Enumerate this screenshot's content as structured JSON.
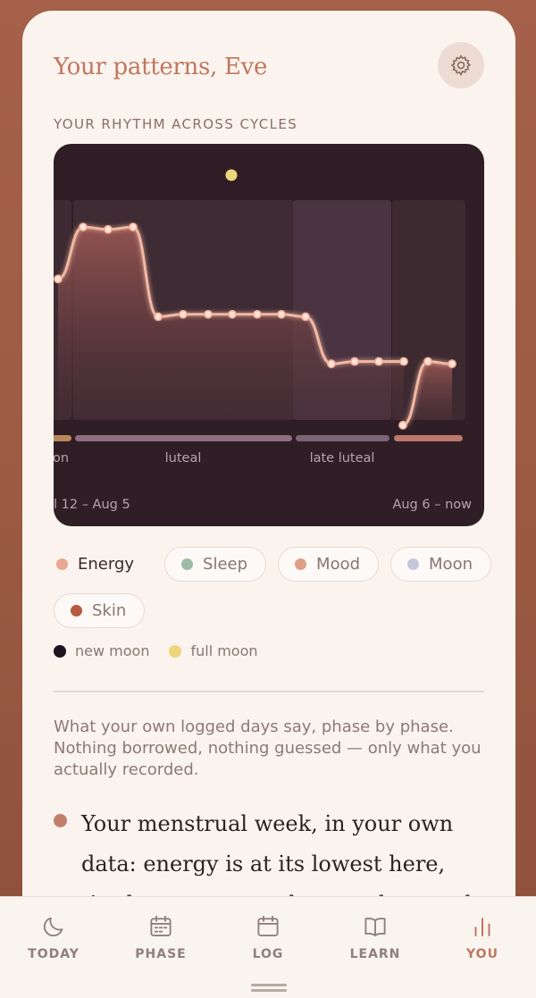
{
  "header": {
    "title": "Your patterns, Eve",
    "settings_icon": "gear-icon"
  },
  "section_label": "YOUR RHYTHM ACROSS CYCLES",
  "chart_data": {
    "type": "area",
    "series": [
      {
        "name": "Energy",
        "segment": 1,
        "values": [
          3.5,
          4.6,
          4.55,
          4.6,
          2.7,
          2.75,
          2.75,
          2.75,
          2.75,
          2.75,
          2.7,
          1.7,
          1.75,
          1.75,
          1.75
        ]
      },
      {
        "name": "Energy",
        "segment": 2,
        "values": [
          0.4,
          1.75,
          1.7
        ]
      }
    ],
    "phases": [
      {
        "label": "on",
        "color": "#b8875a"
      },
      {
        "label": "luteal",
        "color": "#8e6e80"
      },
      {
        "label": "late luteal",
        "color": "#7a6577"
      },
      {
        "label": "",
        "color": "#b9786a"
      }
    ],
    "range_labels": [
      "12 – Aug 5",
      "Aug 6 – now"
    ],
    "range_start_prefix": "l",
    "full_moon_marker": true
  },
  "legend": [
    {
      "label": "Energy",
      "color": "#e8a891",
      "active": true
    },
    {
      "label": "Sleep",
      "color": "#9dbca8",
      "active": false
    },
    {
      "label": "Mood",
      "color": "#df9f86",
      "active": false
    },
    {
      "label": "Moon",
      "color": "#c5c6d9",
      "active": false
    },
    {
      "label": "Skin",
      "color": "#b65a40",
      "active": false
    }
  ],
  "moon_key": [
    {
      "label": "new moon",
      "color": "#1d1520"
    },
    {
      "label": "full moon",
      "color": "#ecd67c"
    }
  ],
  "intro": "What your own logged days say, phase by phase. Nothing borrowed, nothing guessed — only what you actually recorded.",
  "insight": "Your menstrual week, in your own data: energy is at its lowest here, tiredness on most days, and a mood closer to low",
  "tabs": [
    {
      "label": "TODAY",
      "icon": "moon-icon",
      "active": false
    },
    {
      "label": "PHASE",
      "icon": "calendar-icon",
      "active": false
    },
    {
      "label": "LOG",
      "icon": "calendar-blank-icon",
      "active": false
    },
    {
      "label": "LEARN",
      "icon": "book-icon",
      "active": false
    },
    {
      "label": "YOU",
      "icon": "bars-icon",
      "active": true
    }
  ]
}
